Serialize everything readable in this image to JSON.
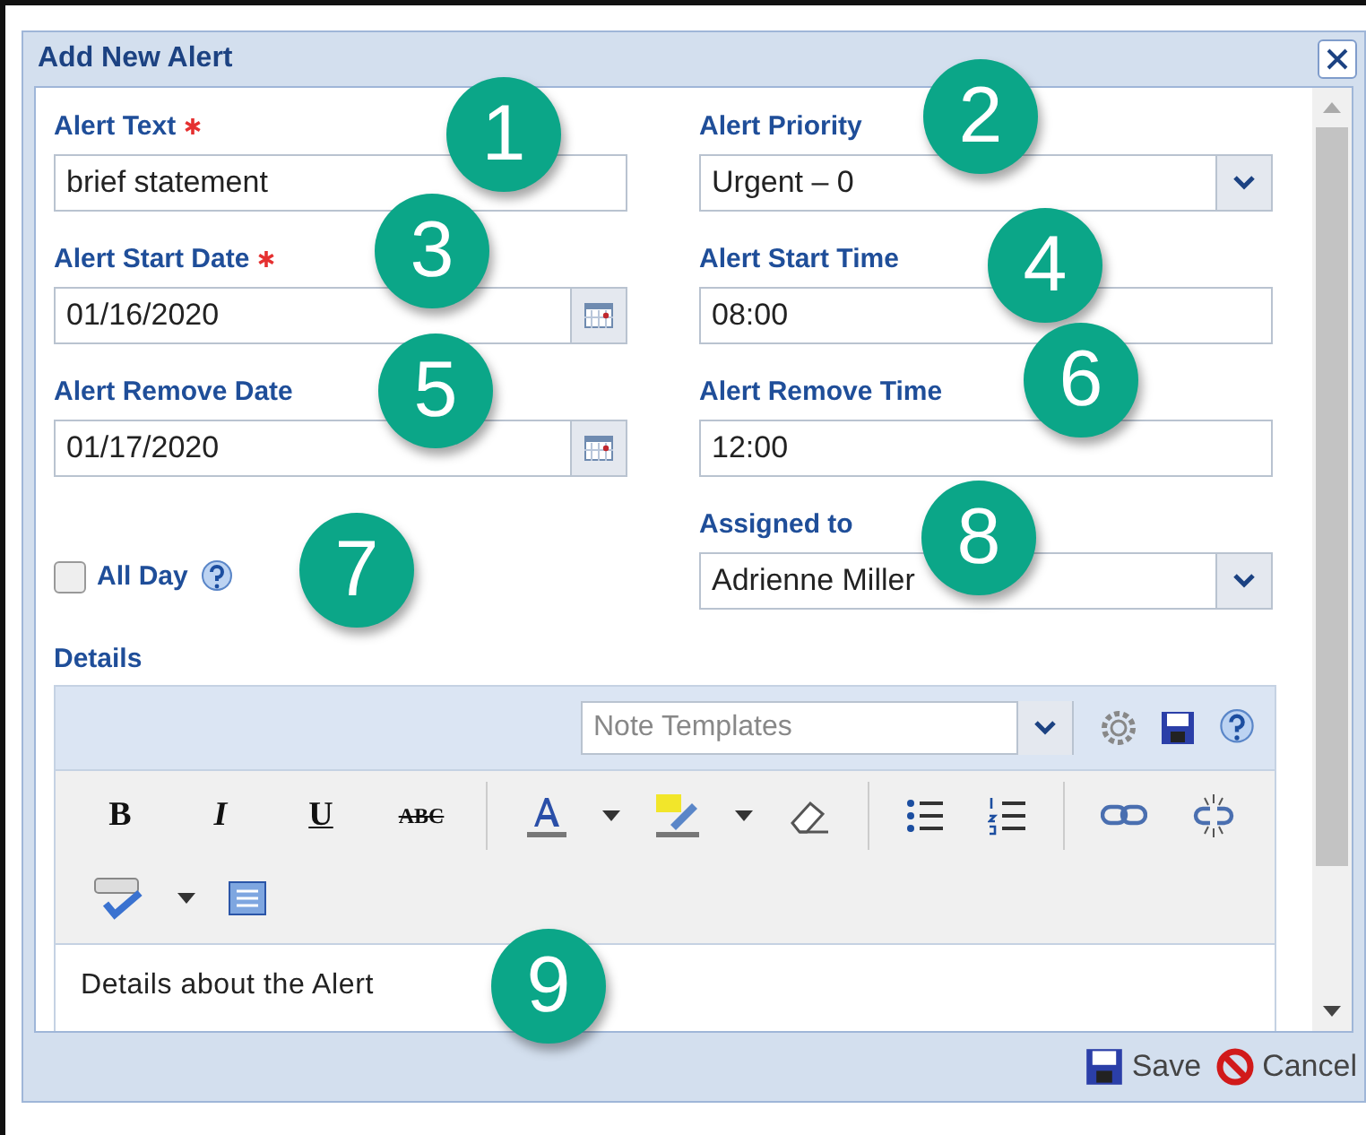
{
  "dialog": {
    "title": "Add New Alert"
  },
  "fields": [
    {
      "label": "Alert Text",
      "required": true,
      "kind": "text",
      "value": "brief statement"
    },
    {
      "label": "Alert Priority",
      "required": false,
      "kind": "select",
      "value": "Urgent – 0"
    },
    {
      "label": "Alert Start Date",
      "required": true,
      "kind": "date",
      "value": "01/16/2020"
    },
    {
      "label": "Alert Start Time",
      "required": false,
      "kind": "text",
      "value": "08:00"
    },
    {
      "label": "Alert Remove Date",
      "required": false,
      "kind": "date",
      "value": "01/17/2020"
    },
    {
      "label": "Alert Remove Time",
      "required": false,
      "kind": "text",
      "value": "12:00"
    },
    {
      "label": "All Day",
      "kind": "checkbox",
      "checked": false
    },
    {
      "label": "Assigned to",
      "required": false,
      "kind": "select",
      "value": "Adrienne Miller"
    }
  ],
  "details": {
    "label": "Details",
    "templates": {
      "placeholder": "Note Templates"
    },
    "toolbar": [
      {
        "kind": "bold",
        "label": "B"
      },
      {
        "kind": "italic",
        "label": "I"
      },
      {
        "kind": "underline",
        "label": "U"
      },
      {
        "kind": "strike",
        "label": "ABC"
      },
      {
        "kind": "sep"
      },
      {
        "kind": "fontcolor"
      },
      {
        "kind": "caret"
      },
      {
        "kind": "highlight"
      },
      {
        "kind": "caret"
      },
      {
        "kind": "eraser"
      },
      {
        "kind": "sep"
      },
      {
        "kind": "bullets"
      },
      {
        "kind": "numbers"
      },
      {
        "kind": "sep"
      },
      {
        "kind": "link"
      },
      {
        "kind": "unlink"
      },
      {
        "kind": "break"
      },
      {
        "kind": "spell"
      },
      {
        "kind": "caret"
      },
      {
        "kind": "block"
      }
    ],
    "content": "Details about the Alert"
  },
  "footer": {
    "buttons": [
      {
        "kind": "save",
        "label": "Save"
      },
      {
        "kind": "cancel",
        "label": "Cancel"
      }
    ]
  },
  "callouts": [
    "1",
    "2",
    "3",
    "4",
    "5",
    "6",
    "7",
    "8",
    "9"
  ]
}
